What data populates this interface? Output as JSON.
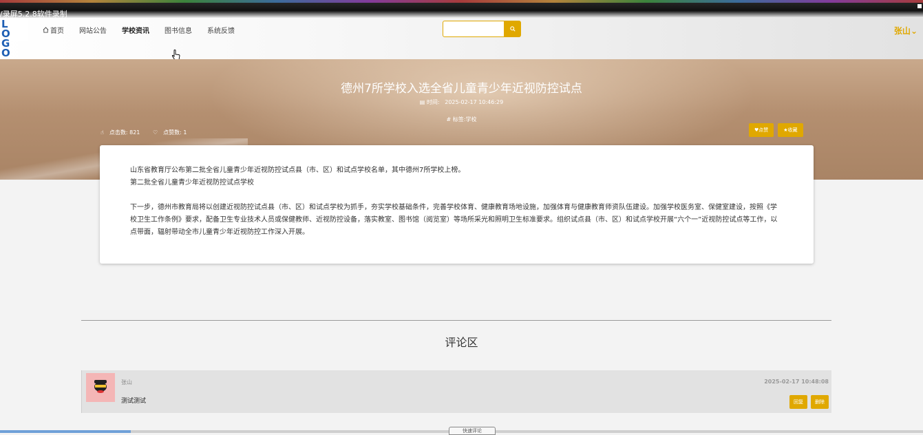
{
  "recorder": {
    "title": "/录屏5.2.8软件录制"
  },
  "header": {
    "logo": "LO GO",
    "nav": [
      {
        "label": "首页"
      },
      {
        "label": "网站公告"
      },
      {
        "label": "学校资讯"
      },
      {
        "label": "图书信息"
      },
      {
        "label": "系统反馈"
      }
    ],
    "search": {
      "placeholder": ""
    },
    "user": "张山"
  },
  "article": {
    "title": "德州7所学校入选全省儿童青少年近视防控试点",
    "time_label": "时间:",
    "time": "2025-02-17 10:46:29",
    "tag": "# 标签:学校",
    "clicks": "点击数: 821",
    "likes": "点赞数: 1",
    "like_button": "点赞",
    "favorite_button": "收藏",
    "paragraphs": [
      "山东省教育厅公布第二批全省儿童青少年近视防控试点县（市、区）和试点学校名单，其中德州7所学校上榜。",
      "第二批全省儿童青少年近视防控试点学校",
      "",
      "下一步，德州市教育局将以创建近视防控试点县（市、区）和试点学校为抓手，夯实学校基础条件，完善学校体育、健康教育场地设施，加强体育与健康教育师资队伍建设。加强学校医务室、保健室建设，按照《学校卫生工作条例》要求，配备卫生专业技术人员或保健教师、近视防控设备，落实教室、图书馆（阅览室）等场所采光和照明卫生标准要求。组织试点县（市、区）和试点学校开展“六个一”近视防控试点等工作，以点带面，辐射带动全市儿童青少年近视防控工作深入开展。"
    ]
  },
  "comments": {
    "heading": "评论区",
    "items": [
      {
        "user": "张山",
        "text": "测试测试",
        "time": "2025-02-17 10:48:08",
        "reply": "回复",
        "delete": "删除"
      }
    ]
  },
  "bottom_tip": "快速评论",
  "colors": {
    "accent": "#e0a800",
    "banner": "#b48f70"
  }
}
